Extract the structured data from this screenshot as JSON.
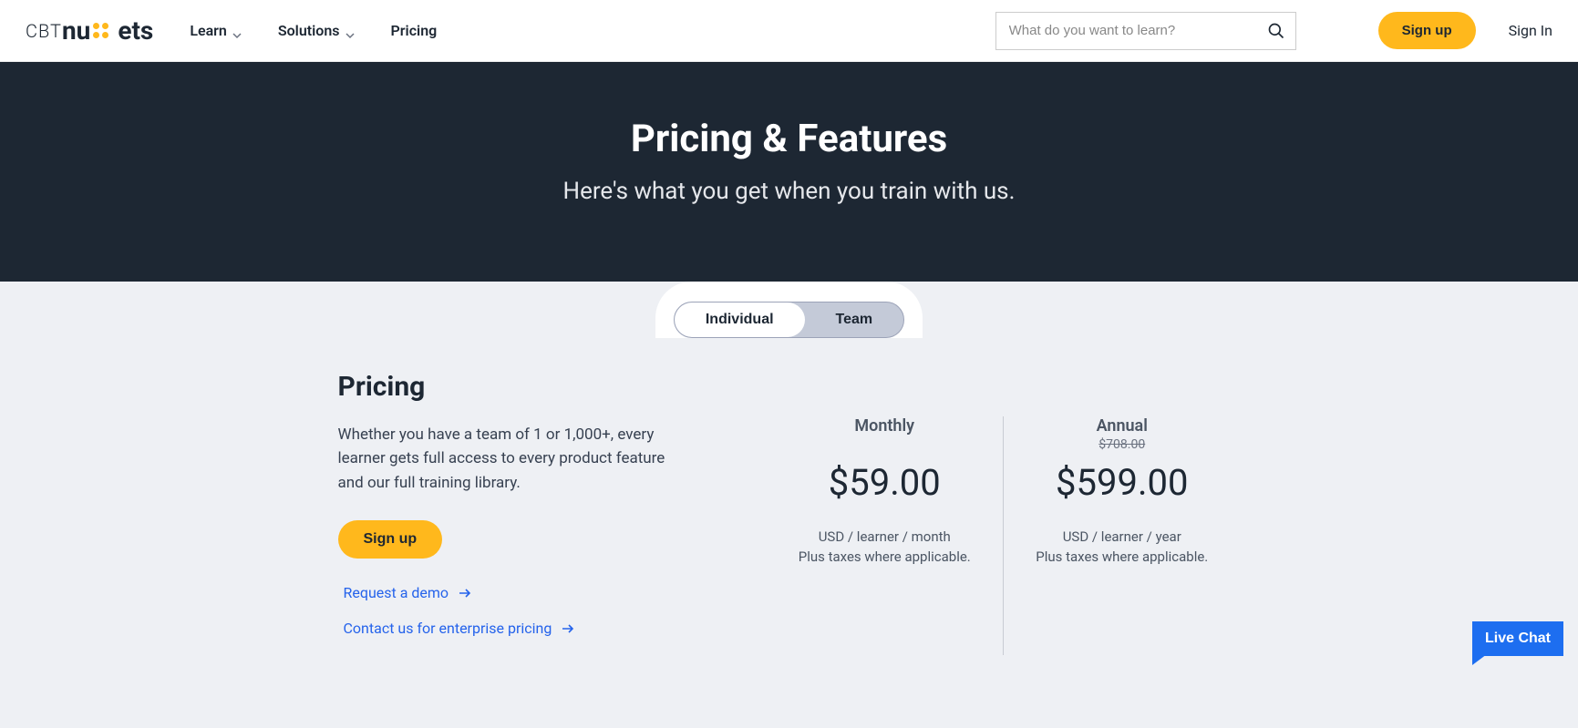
{
  "header": {
    "logo": {
      "cbt": "CBT",
      "nu": "nu",
      "ets": "ets"
    },
    "nav": {
      "learn": "Learn",
      "solutions": "Solutions",
      "pricing": "Pricing"
    },
    "search_placeholder": "What do you want to learn?",
    "signup": "Sign up",
    "signin": "Sign In"
  },
  "hero": {
    "title": "Pricing & Features",
    "subtitle": "Here's what you get when you train with us."
  },
  "toggle": {
    "individual": "Individual",
    "team": "Team"
  },
  "pricing": {
    "heading": "Pricing",
    "body": "Whether you have a team of 1 or 1,000+, every learner gets full access to every product feature and our full training library.",
    "signup": "Sign up",
    "demo_link": "Request a demo",
    "enterprise_link": "Contact us for enterprise pricing"
  },
  "plans": {
    "monthly": {
      "label": "Monthly",
      "strike": "",
      "price": "$59.00",
      "sub1": "USD / learner / month",
      "sub2": "Plus taxes where applicable."
    },
    "annual": {
      "label": "Annual",
      "strike": "$708.00",
      "price": "$599.00",
      "sub1": "USD / learner / year",
      "sub2": "Plus taxes where applicable."
    }
  },
  "chat": {
    "label": "Live Chat"
  }
}
